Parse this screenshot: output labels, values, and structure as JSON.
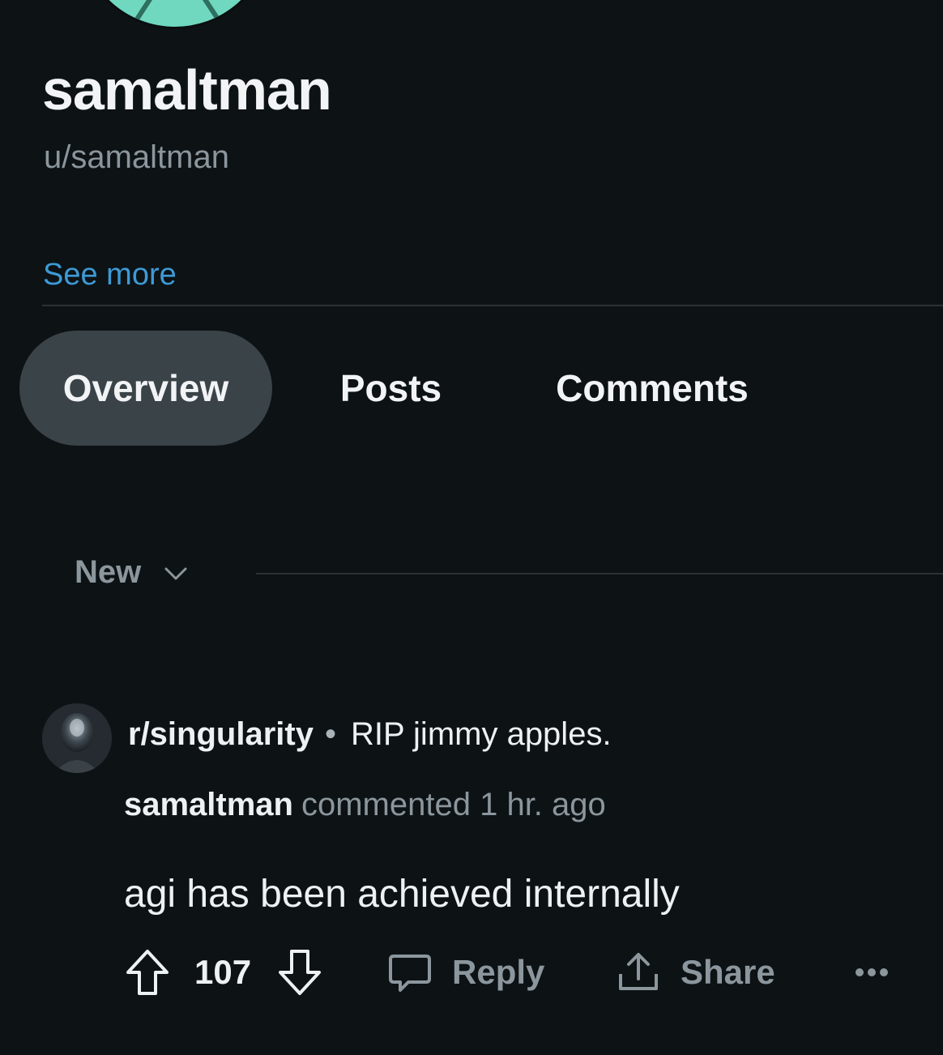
{
  "profile": {
    "display_name": "samaltman",
    "username": "u/samaltman",
    "see_more_label": "See more",
    "avatar_icon": "profile-avatar-icon"
  },
  "tabs": [
    {
      "label": "Overview",
      "active": true
    },
    {
      "label": "Posts",
      "active": false
    },
    {
      "label": "Comments",
      "active": false
    }
  ],
  "sort": {
    "label": "New",
    "icon": "chevron-down-icon"
  },
  "comment": {
    "subreddit": "r/singularity",
    "separator": "•",
    "post_title": "RIP jimmy apples.",
    "author": "samaltman",
    "meta": "commented 1 hr. ago",
    "body": "agi has been achieved internally",
    "score": "107",
    "reply_label": "Reply",
    "share_label": "Share",
    "icons": [
      "arrow-up-icon",
      "arrow-down-icon",
      "speech-bubble-icon",
      "share-icon",
      "more-icon"
    ]
  },
  "colors": {
    "background": "#0d1215",
    "link": "#3d9ad6",
    "muted_text": "#8b969d",
    "active_tab": "#3a4348",
    "avatar_accent": "#6fd8bf"
  }
}
